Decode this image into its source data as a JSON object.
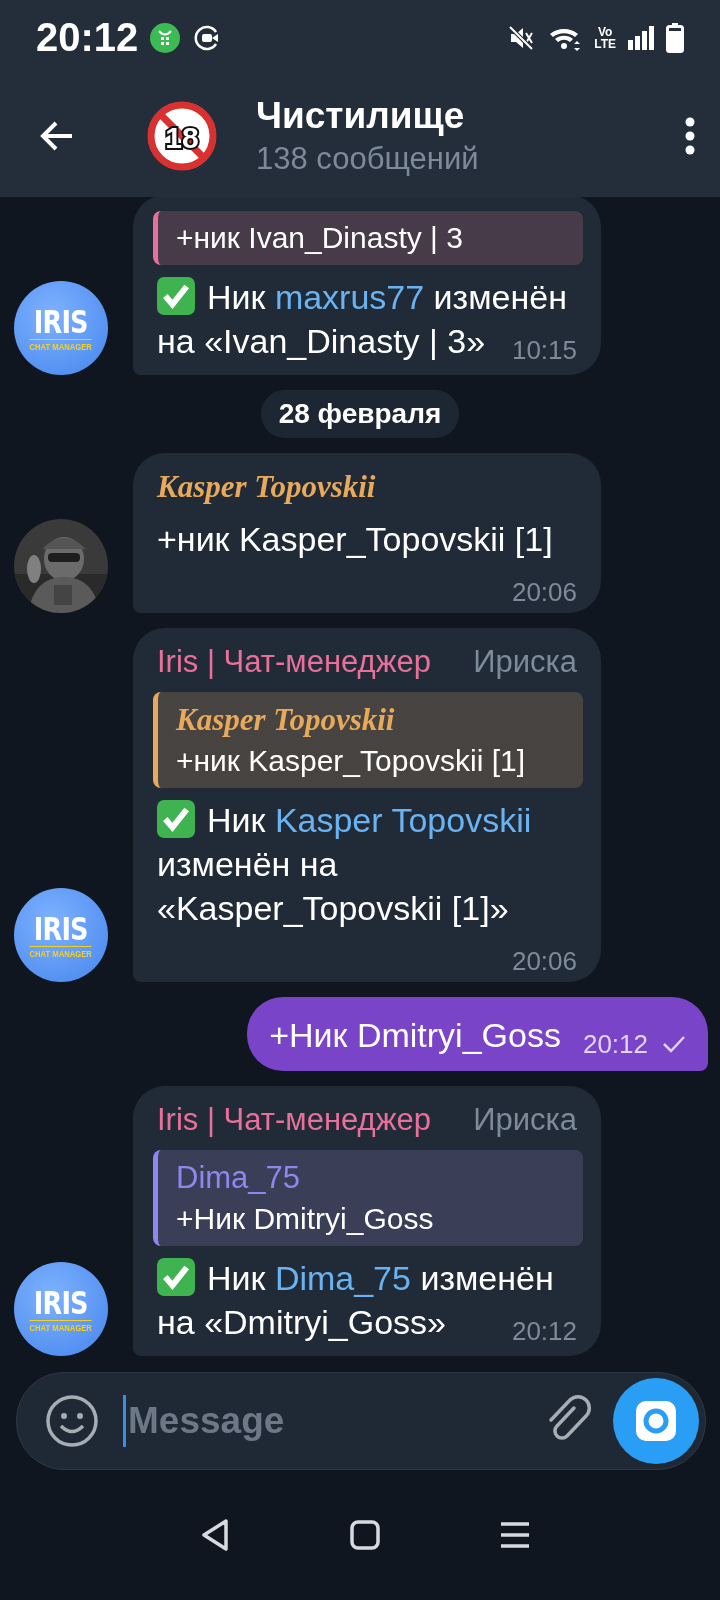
{
  "status_bar": {
    "time": "20:12",
    "network_label": [
      "Vo",
      "LTE"
    ]
  },
  "header": {
    "title": "Чистилище",
    "subtitle": "138 сообщений",
    "avatar_badge": "18"
  },
  "messages": [
    {
      "kind": "incoming",
      "avatar": {
        "kind": "logo",
        "title": "IRIS",
        "subtitle": "CHAT MANAGER"
      },
      "quote": {
        "text": "+ник Ivan_Dinasty | 3",
        "color": "#e8709a"
      },
      "check_mark": true,
      "parts": [
        {
          "kind": "plain",
          "text": "Ник "
        },
        {
          "kind": "mention",
          "text": "maxrus77"
        },
        {
          "kind": "plain",
          "text": " изменён на «Ivan_Dinasty | 3»"
        }
      ],
      "time": "10:15"
    },
    {
      "kind": "date",
      "text": "28 февраля"
    },
    {
      "kind": "incoming",
      "avatar": {
        "kind": "picture"
      },
      "sender": {
        "kind": "stylized",
        "name": "Kasper Topovskii",
        "color": "#e8a95a"
      },
      "check_mark": false,
      "parts": [
        {
          "kind": "plain",
          "text": "+ник Kasper_Topovskii [1]"
        }
      ],
      "time": "20:06"
    },
    {
      "kind": "incoming",
      "avatar": {
        "kind": "logo",
        "title": "IRIS",
        "subtitle": "CHAT MANAGER"
      },
      "sender": {
        "kind": "plain",
        "name": "Iris | Чат-менеджер",
        "color": "#e8709a",
        "role": "Ириска"
      },
      "quote": {
        "author": {
          "kind": "stylized",
          "name": "Kasper Topovskii"
        },
        "text": "+ник Kasper_Topovskii [1]",
        "color": "#e8a95a"
      },
      "check_mark": true,
      "parts": [
        {
          "kind": "plain",
          "text": "Ник "
        },
        {
          "kind": "mention",
          "text": "Kasper Topovskii"
        },
        {
          "kind": "plain",
          "text": " изменён на «Kasper_Topovskii [1]»"
        }
      ],
      "time": "20:06"
    },
    {
      "kind": "outgoing",
      "parts": [
        {
          "kind": "plain",
          "text": "+Ник Dmitryi_Goss"
        }
      ],
      "time": "20:12",
      "read": false
    },
    {
      "kind": "incoming",
      "avatar": {
        "kind": "logo",
        "title": "IRIS",
        "subtitle": "CHAT MANAGER"
      },
      "sender": {
        "kind": "plain",
        "name": "Iris | Чат-менеджер",
        "color": "#e8709a",
        "role": "Ириска"
      },
      "quote": {
        "author": {
          "kind": "plain",
          "name": "Dima_75"
        },
        "text": "+Ник Dmitryi_Goss",
        "color": "#8f86f0"
      },
      "check_mark": true,
      "parts": [
        {
          "kind": "plain",
          "text": "Ник "
        },
        {
          "kind": "mention",
          "text": "Dima_75"
        },
        {
          "kind": "plain",
          "text": " изменён на «Dmitryi_Goss»"
        }
      ],
      "time": "20:12"
    }
  ],
  "composer": {
    "placeholder": "Message"
  }
}
